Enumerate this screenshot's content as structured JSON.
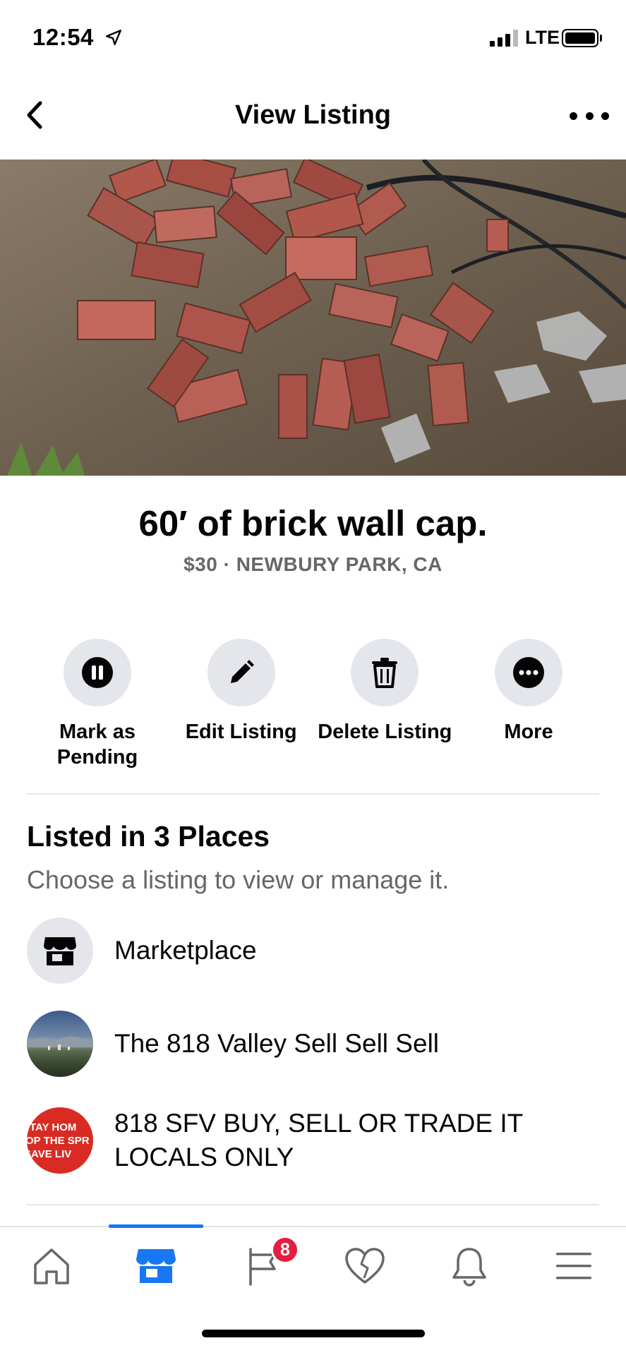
{
  "status_bar": {
    "time": "12:54",
    "network": "LTE",
    "icons": [
      "location-arrow-icon",
      "signal-icon",
      "battery-icon"
    ]
  },
  "header": {
    "title": "View Listing",
    "back_icon": "chevron-left-icon",
    "more_icon": "more-horizontal-icon"
  },
  "listing": {
    "photo_description_icon": "photo",
    "title": "60′ of brick wall cap.",
    "meta": "$30 · NEWBURY PARK, CA"
  },
  "actions": [
    {
      "label": "Mark as Pending",
      "icon": "pause-icon"
    },
    {
      "label": "Edit Listing",
      "icon": "pencil-icon"
    },
    {
      "label": "Delete Listing",
      "icon": "trash-icon"
    },
    {
      "label": "More",
      "icon": "more-icon"
    }
  ],
  "listed_in": {
    "title": "Listed in 3 Places",
    "subtitle": "Choose a listing to view or manage it.",
    "places": [
      {
        "label": "Marketplace",
        "icon": "marketplace-store-icon"
      },
      {
        "label": "The 818 Valley Sell Sell Sell",
        "icon": "group-photo"
      },
      {
        "label": "818 SFV BUY, SELL OR TRADE IT LOCALS ONLY",
        "icon": "group-photo",
        "avatar_text": [
          "TAY HOM",
          "OP THE SPR",
          "SAVE LIV"
        ]
      }
    ]
  },
  "tab_bar": {
    "active_index": 1,
    "tabs": [
      {
        "name": "home",
        "icon": "home-icon"
      },
      {
        "name": "marketplace",
        "icon": "marketplace-icon"
      },
      {
        "name": "pages",
        "icon": "flag-icon",
        "badge": "8"
      },
      {
        "name": "dating",
        "icon": "heart-icon"
      },
      {
        "name": "notifications",
        "icon": "bell-icon"
      },
      {
        "name": "menu",
        "icon": "hamburger-menu-icon"
      }
    ]
  },
  "colors": {
    "accent": "#1877f2",
    "secondary_text": "#65676b",
    "button_bg": "#e4e6eb",
    "badge": "#e41e3f"
  }
}
